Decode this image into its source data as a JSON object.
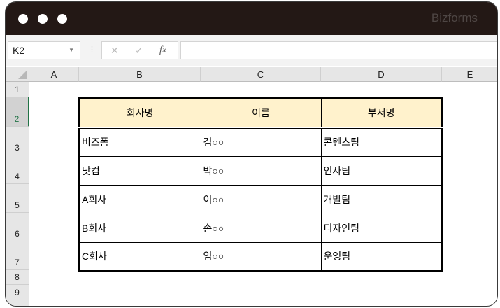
{
  "window": {
    "brand": "Bizforms"
  },
  "formula_bar": {
    "name_box": "K2",
    "cancel": "✕",
    "enter": "✓",
    "fx": "fx",
    "value": ""
  },
  "columns": [
    "A",
    "B",
    "C",
    "D",
    "E"
  ],
  "rows": [
    "1",
    "2",
    "3",
    "4",
    "5",
    "6",
    "7",
    "8",
    "9"
  ],
  "table": {
    "headers": [
      "회사명",
      "이름",
      "부서명"
    ],
    "rows": [
      [
        "비즈폼",
        "김○○",
        "콘텐츠팀"
      ],
      [
        "닷컴",
        "박○○",
        "인사팀"
      ],
      [
        "A회사",
        "이○○",
        "개발팀"
      ],
      [
        "B회사",
        "손○○",
        "디자인팀"
      ],
      [
        "C회사",
        "임○○",
        "운영팀"
      ]
    ]
  }
}
